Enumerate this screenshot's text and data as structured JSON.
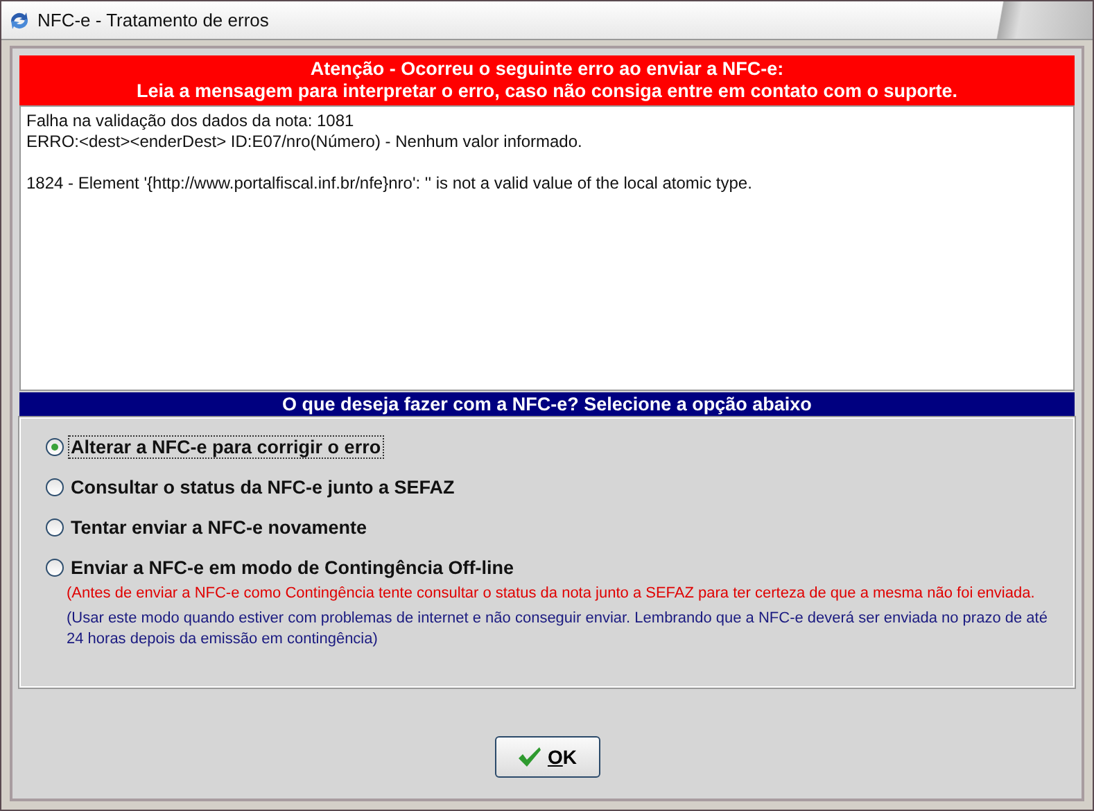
{
  "window": {
    "title": "NFC-e - Tratamento de erros"
  },
  "alert": {
    "lines": [
      "Atenção - Ocorreu o seguinte erro ao enviar a NFC-e:",
      "Leia a mensagem para interpretar o erro, caso não consiga entre em contato com o suporte."
    ]
  },
  "message": {
    "paragraphs": [
      {
        "lines": [
          "Falha na validação dos dados da nota: 1081",
          "ERRO:<dest><enderDest> ID:E07/nro(Número) - Nenhum valor informado."
        ]
      },
      {
        "lines": [
          "1824 - Element '{http://www.portalfiscal.inf.br/nfe}nro': '' is not a valid value of the local atomic type."
        ]
      }
    ]
  },
  "options_header": "O que deseja fazer com a NFC-e? Selecione a opção abaixo",
  "options": [
    {
      "label": "Alterar a NFC-e para corrigir o erro",
      "selected": true
    },
    {
      "label": "Consultar o status da NFC-e junto a SEFAZ",
      "selected": false
    },
    {
      "label": "Tentar enviar a NFC-e novamente",
      "selected": false
    },
    {
      "label": "Enviar a NFC-e em modo de Contingência Off-line",
      "selected": false,
      "notes": [
        {
          "kind": "warning",
          "text": "(Antes de enviar a NFC-e como Contingência tente consultar o status da nota junto a SEFAZ para ter certeza de que a mesma não foi enviada."
        },
        {
          "kind": "info",
          "text": "(Usar este modo quando estiver com problemas de internet e não conseguir enviar. Lembrando que a NFC-e deverá ser enviada no prazo de até 24 horas depois da emissão em contingência)"
        }
      ]
    }
  ],
  "ok_button": {
    "mnemonic": "O",
    "rest": "K"
  }
}
